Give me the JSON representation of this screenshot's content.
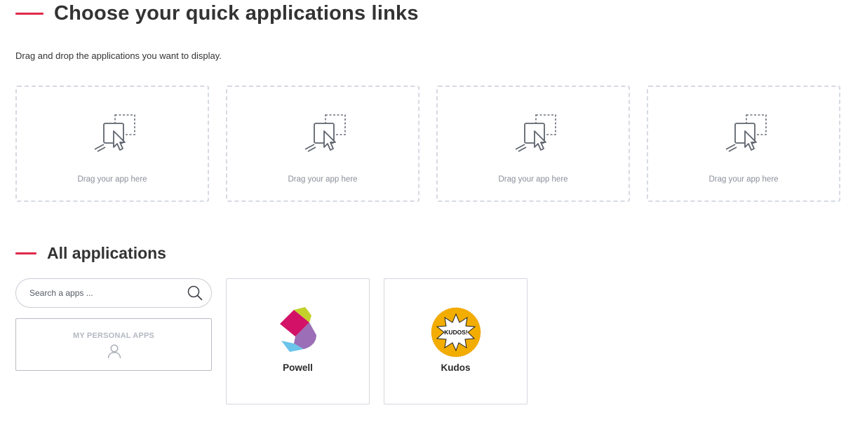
{
  "quick_links": {
    "title": "Choose your quick applications links",
    "subtitle": "Drag and drop the applications you want to display.",
    "dropzones": [
      {
        "label": "Drag your app here"
      },
      {
        "label": "Drag your app here"
      },
      {
        "label": "Drag your app here"
      },
      {
        "label": "Drag your app here"
      }
    ]
  },
  "all_apps": {
    "title": "All applications",
    "search": {
      "placeholder": "Search a apps ...",
      "value": ""
    },
    "personal_apps_label": "MY PERSONAL APPS",
    "apps": [
      {
        "name": "Powell",
        "icon": "powell-logo"
      },
      {
        "name": "Kudos",
        "icon": "kudos-logo",
        "logo_text": "KUDOS!"
      }
    ]
  },
  "colors": {
    "accent": "#e0294a",
    "dropzone_border": "#d6dae3",
    "muted_text": "#8a8f99"
  }
}
